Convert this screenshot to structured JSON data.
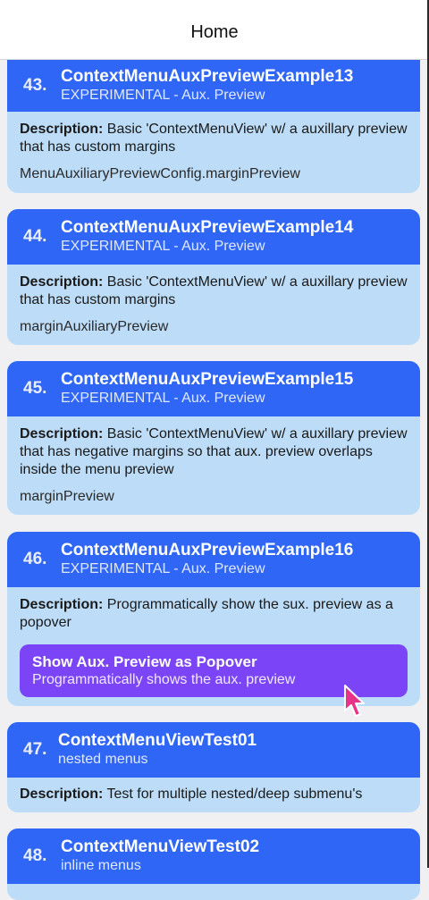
{
  "navbar": {
    "title": "Home"
  },
  "labels": {
    "description": "Description:"
  },
  "cards": [
    {
      "num": "43.",
      "title": "ContextMenuAuxPreviewExample13",
      "subtitle": "EXPERIMENTAL - Aux. Preview",
      "description": "Basic 'ContextMenuView' w/ a auxillary preview that has custom margins",
      "extra": "MenuAuxiliaryPreviewConfig.marginPreview"
    },
    {
      "num": "44.",
      "title": "ContextMenuAuxPreviewExample14",
      "subtitle": "EXPERIMENTAL - Aux. Preview",
      "description": "Basic 'ContextMenuView' w/ a auxillary preview that has custom margins",
      "extra": "marginAuxiliaryPreview"
    },
    {
      "num": "45.",
      "title": "ContextMenuAuxPreviewExample15",
      "subtitle": "EXPERIMENTAL - Aux. Preview",
      "description": "Basic 'ContextMenuView' w/ a auxillary preview that has negative margins so that aux. preview overlaps inside the menu preview",
      "extra": "marginPreview"
    },
    {
      "num": "46.",
      "title": "ContextMenuAuxPreviewExample16",
      "subtitle": "EXPERIMENTAL - Aux. Preview",
      "description": "Programmatically show the sux. preview as a popover",
      "button_title": "Show Aux. Preview as Popover",
      "button_subtitle": "Programmatically shows the aux. preview"
    },
    {
      "num": "47.",
      "title": "ContextMenuViewTest01",
      "subtitle": "nested menus",
      "description": "Test for multiple nested/deep submenu's"
    },
    {
      "num": "48.",
      "title": "ContextMenuViewTest02",
      "subtitle": "inline menus"
    }
  ],
  "colors": {
    "header": "#2f66f6",
    "body": "#bcdcf7",
    "button": "#7b44f7",
    "cursor": "#e8338a"
  },
  "icons": {
    "cursor": "pointer-cursor-icon"
  }
}
